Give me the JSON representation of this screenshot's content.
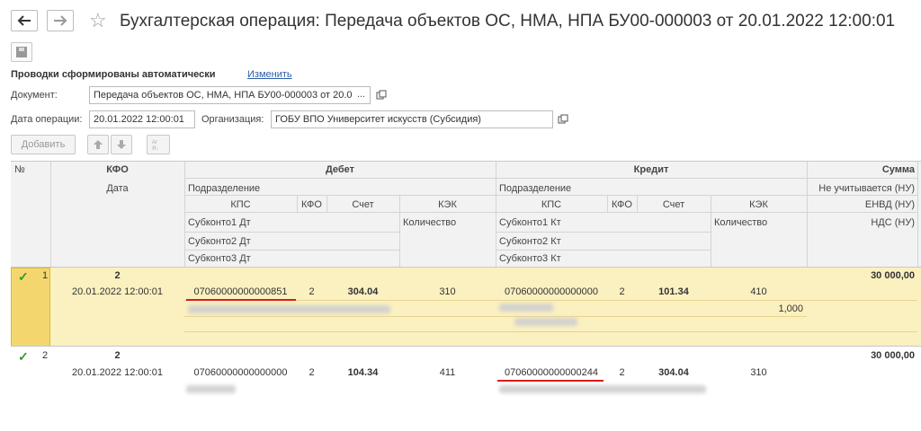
{
  "window": {
    "title": "Бухгалтерская операция: Передача объектов ОС, НМА, НПА БУ00-000003 от 20.01.2022 12:00:01",
    "back_icon": "arrow-left-icon",
    "forward_icon": "arrow-right-icon",
    "favorite_icon": "star-icon",
    "save_icon": "floppy-icon"
  },
  "form": {
    "auto_postings_label": "Проводки сформированы автоматически",
    "change_link": "Изменить",
    "document_label": "Документ:",
    "document_value": "Передача объектов ОС, НМА, НПА БУ00-000003 от 20.0",
    "document_ellipsis": "...",
    "date_label": "Дата операции:",
    "date_value": "20.01.2022 12:00:01",
    "org_label": "Организация:",
    "org_value": "ГОБУ ВПО Университет искусств (Субсидия)"
  },
  "toolbar": {
    "add_label": "Добавить"
  },
  "table": {
    "headers": {
      "num": "№",
      "kfo": "КФО",
      "date": "Дата",
      "debit": "Дебет",
      "credit": "Кредит",
      "sum": "Сумма",
      "dt_division": "Подразделение",
      "dt_kps": "КПС",
      "dt_kfo": "КФО",
      "dt_account": "Счет",
      "dt_kek": "КЭК",
      "dt_sub1": "Субконто1 Дт",
      "dt_qty": "Количество",
      "dt_sub2": "Субконто2 Дт",
      "dt_sub3": "Субконто3 Дт",
      "kt_division": "Подразделение",
      "kt_kps": "КПС",
      "kt_kfo": "КФО",
      "kt_account": "Счет",
      "kt_kek": "КЭК",
      "kt_sub1": "Субконто1 Кт",
      "kt_qty": "Количество",
      "kt_sub2": "Субконто2 Кт",
      "kt_sub3": "Субконто3 Кт",
      "not_counted": "Не учитывается (НУ)",
      "envd": "ЕНВД (НУ)",
      "vat": "НДС (НУ)"
    },
    "rows": [
      {
        "num": "1",
        "kfo": "2",
        "date": "20.01.2022 12:00:01",
        "dt_kps": "07060000000000851",
        "dt_kfo": "2",
        "dt_account": "304.04",
        "dt_kek": "310",
        "kt_kps": "07060000000000000",
        "kt_kfo": "2",
        "kt_account": "101.34",
        "kt_kek": "410",
        "kt_qty": "1,000",
        "sum": "30 000,00"
      },
      {
        "num": "2",
        "kfo": "2",
        "date": "20.01.2022 12:00:01",
        "dt_kps": "07060000000000000",
        "dt_kfo": "2",
        "dt_account": "104.34",
        "dt_kek": "411",
        "kt_kps": "07060000000000244",
        "kt_kfo": "2",
        "kt_account": "304.04",
        "kt_kek": "310",
        "sum": "30 000,00"
      }
    ]
  },
  "colors": {
    "selected_row_bg": "#fbf0c0",
    "selected_cell_bg": "#f3d76e",
    "check": "#2e9a2e",
    "underline": "#d81b1b",
    "link": "#2a5ea8"
  }
}
